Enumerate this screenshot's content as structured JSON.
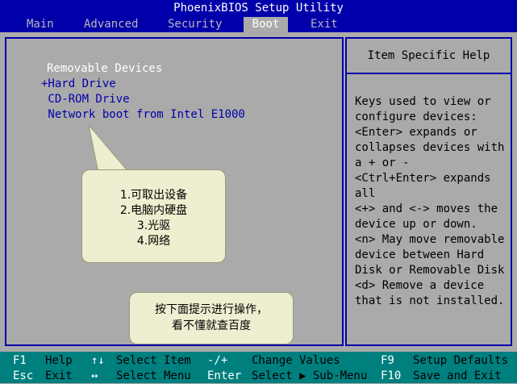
{
  "title": "PhoenixBIOS Setup Utility",
  "menu": [
    "Main",
    "Advanced",
    "Security",
    "Boot",
    "Exit"
  ],
  "active_menu": "Boot",
  "boot": {
    "heading": "Removable Devices",
    "items": [
      "+Hard Drive",
      " CD-ROM Drive",
      " Network boot from Intel E1000"
    ]
  },
  "help": {
    "title": "Item Specific Help",
    "text": "Keys used to view or\nconfigure devices:\n<Enter> expands or\ncollapses devices with\na + or -\n<Ctrl+Enter> expands\nall\n<+> and <-> moves the\ndevice up or down.\n<n> May move removable\ndevice between Hard\nDisk or Removable Disk\n<d> Remove a device\nthat is not installed."
  },
  "callouts": {
    "devices": [
      "1.可取出设备",
      "2.电脑内硬盘",
      "3.光驱",
      "4.网络"
    ],
    "instruction": [
      "按下面提示进行操作，",
      "看不懂就查百度"
    ]
  },
  "status": {
    "row1": [
      {
        "key": "F1",
        "label": "Help"
      },
      {
        "key": "↑↓",
        "label": "Select Item"
      },
      {
        "key": "-/+",
        "label": "Change Values"
      },
      {
        "key": "F9",
        "label": "Setup Defaults"
      }
    ],
    "row2": [
      {
        "key": "Esc",
        "label": "Exit"
      },
      {
        "key": "↔",
        "label": "Select Menu"
      },
      {
        "key": "Enter",
        "label": "Select ▶ Sub-Menu"
      },
      {
        "key": "F10",
        "label": "Save and Exit"
      }
    ]
  },
  "colors": {
    "bios_blue": "#0000aa",
    "bios_gray": "#aaaaaa",
    "status_teal": "#007f7f",
    "callout_fill": "#eeeed0"
  }
}
